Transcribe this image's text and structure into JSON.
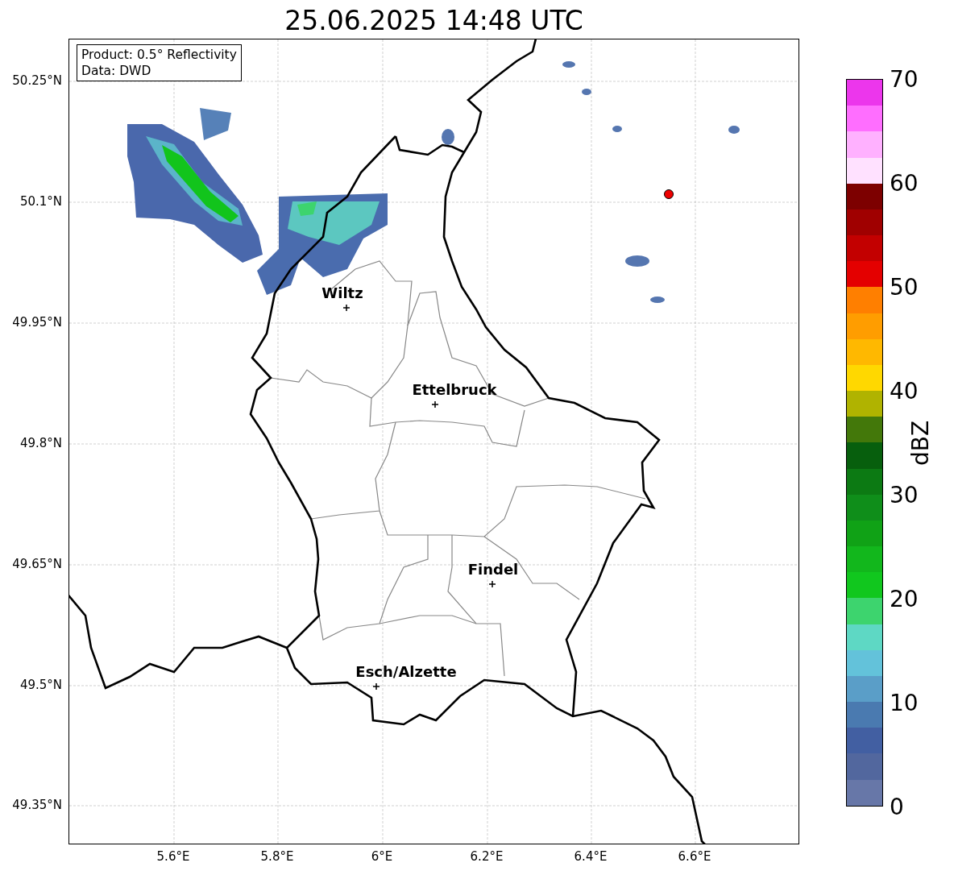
{
  "title": "25.06.2025 14:48 UTC",
  "info_box": [
    "Product: 0.5° Reflectivity",
    "Data: DWD"
  ],
  "lat_ticks": [
    "50.25°N",
    "50.1°N",
    "49.95°N",
    "49.8°N",
    "49.65°N",
    "49.5°N",
    "49.35°N"
  ],
  "lon_ticks": [
    "5.6°E",
    "5.8°E",
    "6°E",
    "6.2°E",
    "6.4°E",
    "6.6°E"
  ],
  "cities": [
    {
      "name": "Wiltz"
    },
    {
      "name": "Ettelbruck"
    },
    {
      "name": "Findel"
    },
    {
      "name": "Esch/Alzette"
    }
  ],
  "colorbar": {
    "label": "dBZ",
    "ticks": [
      "70",
      "60",
      "50",
      "40",
      "30",
      "20",
      "10",
      "0"
    ],
    "segments": [
      {
        "color": "#ec36ec"
      },
      {
        "color": "#ff6eff"
      },
      {
        "color": "#ffb1ff"
      },
      {
        "color": "#ffe1ff"
      },
      {
        "color": "#7d0000"
      },
      {
        "color": "#a00000"
      },
      {
        "color": "#c30000"
      },
      {
        "color": "#e40000"
      },
      {
        "color": "#ff7f00"
      },
      {
        "color": "#ff9d00"
      },
      {
        "color": "#ffb800"
      },
      {
        "color": "#ffd800"
      },
      {
        "color": "#b0b300"
      },
      {
        "color": "#43780a"
      },
      {
        "color": "#075f0d"
      },
      {
        "color": "#0c7a13"
      },
      {
        "color": "#0f8e1a"
      },
      {
        "color": "#10a216"
      },
      {
        "color": "#12b71c"
      },
      {
        "color": "#11c71e"
      },
      {
        "color": "#3dd46e"
      },
      {
        "color": "#5ed8c4"
      },
      {
        "color": "#63c2da"
      },
      {
        "color": "#5a9ec8"
      },
      {
        "color": "#4a7ab0"
      },
      {
        "color": "#425fa2"
      },
      {
        "color": "#52679e"
      },
      {
        "color": "#6777a8"
      }
    ]
  }
}
